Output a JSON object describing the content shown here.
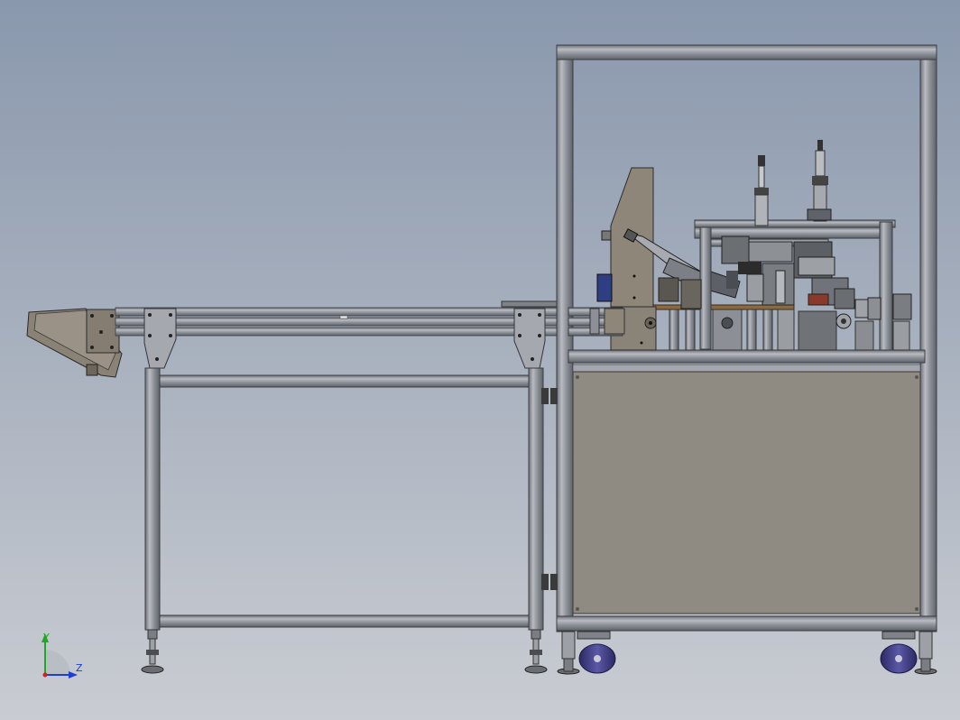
{
  "view": {
    "triad": {
      "y_label": "Y",
      "z_label": "Z",
      "y_color": "#1fa824",
      "z_color": "#1b3fd6",
      "x_color": "#d62020"
    }
  },
  "colors": {
    "background_top": "#8a98ad",
    "background_bottom": "#c9ccd2",
    "frame": "#9b9fa7",
    "panel": "#8f8a82",
    "plate": "#8e8779",
    "caster_wheel": "#3c3a7a"
  }
}
